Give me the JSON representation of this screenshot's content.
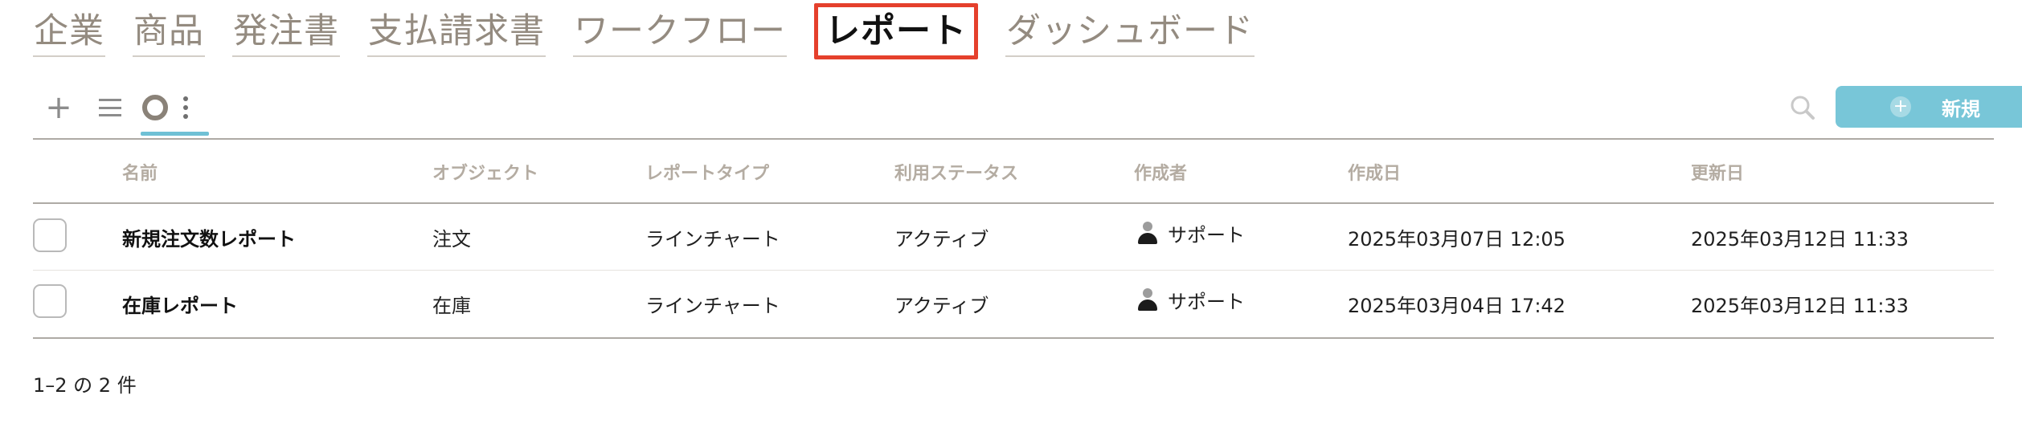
{
  "nav": {
    "items": [
      {
        "label": "企業"
      },
      {
        "label": "商品"
      },
      {
        "label": "発注書"
      },
      {
        "label": "支払請求書"
      },
      {
        "label": "ワークフロー"
      },
      {
        "label": "レポート"
      },
      {
        "label": "ダッシュボード"
      }
    ],
    "active": "レポート"
  },
  "toolbar": {
    "add_icon": "plus-icon",
    "list_icon": "list-icon",
    "view_icon": "ring-icon",
    "more_icon": "more-vertical-icon",
    "search_icon": "search-icon",
    "new_button_label": "新規",
    "new_button_color": "#78c6d8",
    "active_view_underline_color": "#6fc0d5"
  },
  "table": {
    "columns": [
      "名前",
      "オブジェクト",
      "レポートタイプ",
      "利用ステータス",
      "作成者",
      "作成日",
      "更新日"
    ],
    "rows": [
      {
        "name": "新規注文数レポート",
        "object": "注文",
        "report_type": "ラインチャート",
        "status": "アクティブ",
        "author": "サポート",
        "created": "2025年03月07日 12:05",
        "updated": "2025年03月12日 11:33"
      },
      {
        "name": "在庫レポート",
        "object": "在庫",
        "report_type": "ラインチャート",
        "status": "アクティブ",
        "author": "サポート",
        "created": "2025年03月04日 17:42",
        "updated": "2025年03月12日 11:33"
      }
    ]
  },
  "pagination": {
    "summary": "1–2 の 2 件"
  },
  "colors": {
    "nav_inactive": "#948b80",
    "nav_active_border": "#e5402c",
    "header_text": "#b4aca2"
  }
}
